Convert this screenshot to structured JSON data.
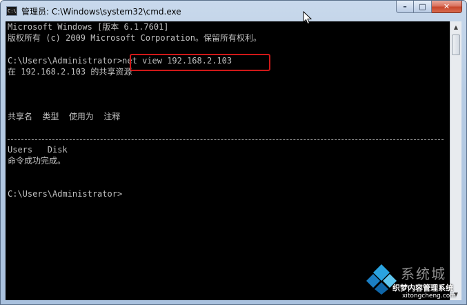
{
  "window": {
    "title": "管理员: C:\\Windows\\system32\\cmd.exe",
    "app_icon_text": "C:\\",
    "controls": {
      "minimize_glyph": "–",
      "maximize_glyph": "□",
      "close_glyph": "✕"
    }
  },
  "console": {
    "lines": [
      "Microsoft Windows [版本 6.1.7601]",
      "版权所有 (c) 2009 Microsoft Corporation。保留所有权利。",
      "C:\\Users\\Administrator>net view 192.168.2.103",
      "在 192.168.2.103 的共享资源",
      "共享名  类型  使用为  注释",
      "Users   Disk",
      "命令成功完成。",
      "C:\\Users\\Administrator>"
    ],
    "highlight_color": "#d01818"
  },
  "scrollbar": {
    "up_glyph": "▲",
    "down_glyph": "▼"
  },
  "watermark": {
    "big_text": "系统城",
    "small_text": "织梦内容管理系统",
    "url_text": "xitongcheng.com"
  }
}
